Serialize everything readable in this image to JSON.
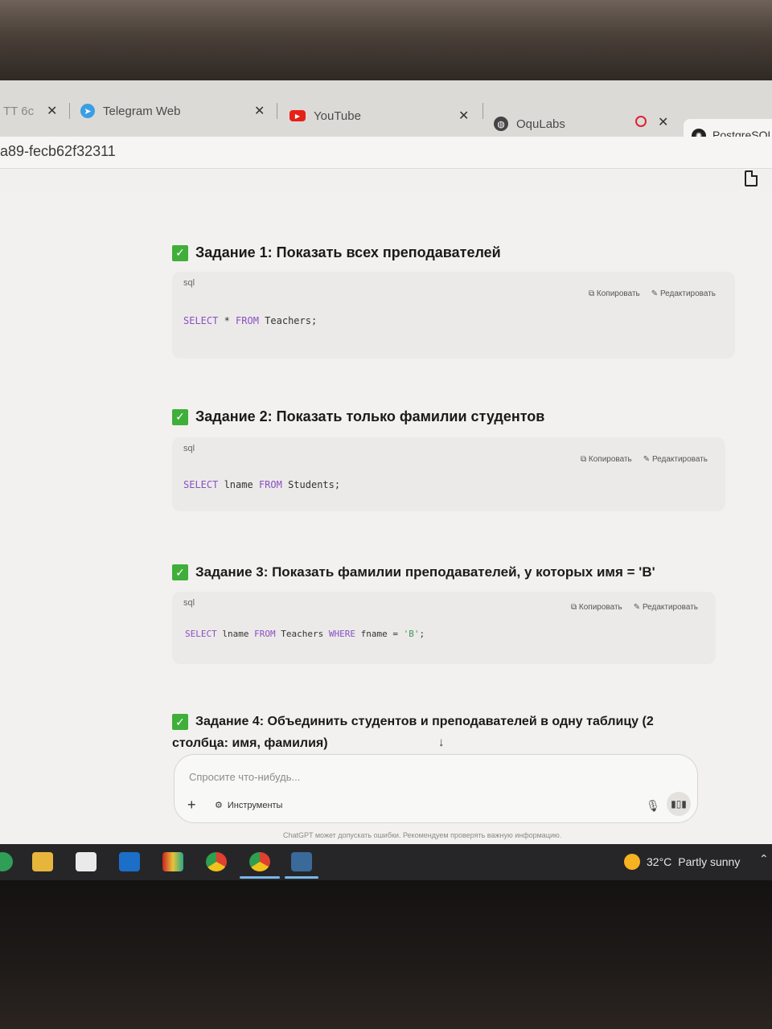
{
  "browser": {
    "tabs": [
      {
        "label": "TT 6c",
        "icon": "tiktok-icon"
      },
      {
        "label": "Telegram Web",
        "icon": "telegram-icon"
      },
      {
        "label": "YouTube",
        "icon": "youtube-icon"
      },
      {
        "label": "OquLabs",
        "icon": "globe-icon"
      },
      {
        "label": "PostgreSQL",
        "icon": "chatgpt-icon"
      }
    ],
    "url_fragment": "a89-fecb62f32311"
  },
  "tasks": [
    {
      "title": "Задание 1: Показать всех преподавателей",
      "lang": "sql",
      "copy_label": "Копировать",
      "edit_label": "Редактировать",
      "code": [
        "SELECT",
        " * ",
        "FROM",
        " Teachers;"
      ]
    },
    {
      "title": "Задание 2: Показать только фамилии студентов",
      "lang": "sql",
      "copy_label": "Копировать",
      "edit_label": "Редактировать",
      "code": [
        "SELECT",
        " lname ",
        "FROM",
        " Students;"
      ]
    },
    {
      "title": "Задание 3: Показать фамилии преподавателей, у которых имя = 'B'",
      "lang": "sql",
      "copy_label": "Копировать",
      "edit_label": "Редактировать",
      "code": [
        "SELECT",
        " lname ",
        "FROM",
        " Teachers ",
        "WHERE",
        " fname = ",
        "'B'",
        ";"
      ]
    },
    {
      "title_line1": "Задание 4: Объединить студентов и преподавателей в одну таблицу (2",
      "title_line2": "столбца: имя, фамилия)"
    }
  ],
  "composer": {
    "placeholder": "Спросите что-нибудь...",
    "tools_label": "Инструменты",
    "disclaimer": "ChatGPT может допускать ошибки. Рекомендуем проверять важную информацию."
  },
  "taskbar": {
    "temperature": "32°C",
    "weather": "Partly sunny",
    "colors": {
      "background": "#262628",
      "accent": "#7ab7e8"
    }
  }
}
